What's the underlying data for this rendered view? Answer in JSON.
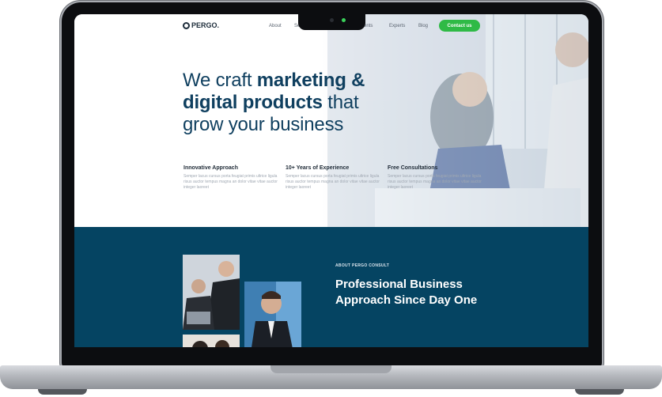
{
  "site": {
    "logo_text": "PERGO.",
    "nav": [
      "About",
      "Se",
      "ents",
      "Experts",
      "Blog"
    ],
    "cta_label": "Contact us"
  },
  "hero": {
    "headline_part1": "We craft ",
    "headline_bold1": "marketing &",
    "headline_bold2": "digital products",
    "headline_part2": " that",
    "headline_part3": "grow your business",
    "features": [
      {
        "title": "Innovative Approach",
        "text": "Semper lacus cursus porta feugiat primis ultrice ligula risus auctor tempus magna an dolor vitae vitae auctor integer laoreet"
      },
      {
        "title": "10+ Years of Experience",
        "text": "Semper lacus cursus porta feugiat primis ultrice ligula risus auctor tempus magna an dolor vitae vitae auctor integer laoreet"
      },
      {
        "title": "Free Consultations",
        "text": "Semper lacus cursus porta feugiat primis ultrice ligula risus auctor tempus magna an dolor vitae vitae auctor integer laoreet"
      }
    ]
  },
  "about": {
    "kicker": "ABOUT PERGO CONSULT",
    "title": "Professional Business Approach Since Day One"
  },
  "colors": {
    "brand_navy": "#054462",
    "headline": "#0f3f5f",
    "cta_green": "#2fba46"
  }
}
